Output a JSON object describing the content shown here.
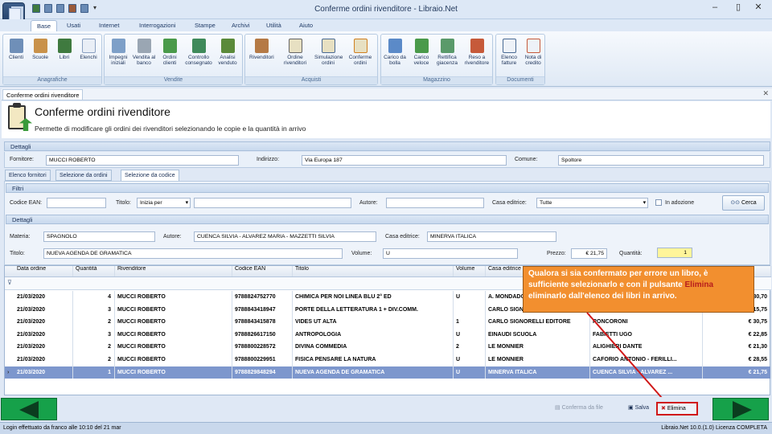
{
  "window": {
    "title": "Conferme ordini rivenditore - Libraio.Net",
    "minimize": "–",
    "maximize": "▯",
    "close": "✕"
  },
  "menu_tabs": [
    "Base",
    "Usati",
    "Internet",
    "Interrogazioni",
    "Stampe",
    "Archivi",
    "Utilità",
    "Aiuto"
  ],
  "ribbon": {
    "anagrafiche": {
      "caption": "Anagrafiche",
      "buttons": [
        "Clienti",
        "Scuole",
        "Libri",
        "Elenchi"
      ]
    },
    "vendite": {
      "caption": "Vendite",
      "buttons": [
        "Impegni iniziali",
        "Vendita al banco",
        "Ordini clienti",
        "Controllo consegnato",
        "Analisi venduto"
      ]
    },
    "acquisti": {
      "caption": "Acquisti",
      "buttons": [
        "Rivenditori",
        "Ordine rivenditori",
        "Simulazione ordini",
        "Conferme ordini"
      ]
    },
    "magazzino": {
      "caption": "Magazzino",
      "buttons": [
        "Carico da bolla",
        "Carico veloce",
        "Rettifica giacenza",
        "Reso a rivenditore"
      ]
    },
    "documenti": {
      "caption": "Documenti",
      "buttons": [
        "Elenco fatture",
        "Nota di credito"
      ]
    }
  },
  "doc_tab": "Conferme ordini rivenditore",
  "header": {
    "title": "Conferme ordini rivenditore",
    "subtitle": "Permette di modificare gli ordini dei rivenditori selezionando le copie e la quantità in arrivo"
  },
  "dettagli": {
    "caption": "Dettagli",
    "fornitore_label": "Fornitore:",
    "fornitore": "MUCCI ROBERTO",
    "indirizzo_label": "Indirizzo:",
    "indirizzo": "Via Europa 187",
    "comune_label": "Comune:",
    "comune": "Spoltore"
  },
  "subtabs": [
    "Elenco fornitori",
    "Selezione da ordini",
    "Selezione da codice"
  ],
  "filtri": {
    "caption": "Filtri",
    "codice_ean_label": "Codice EAN:",
    "titolo_label": "Titolo:",
    "titolo_mode": "Inizia per",
    "autore_label": "Autore:",
    "casa_label": "Casa editrice:",
    "casa_value": "Tutte",
    "in_adozione": "In adozione",
    "cerca": "Cerca"
  },
  "dettagli2": {
    "caption": "Dettagli",
    "materia_label": "Materia:",
    "materia": "SPAGNOLO",
    "autore_label": "Autore:",
    "autore": "CUENCA SILVIA - ALVAREZ MARIA - MAZZETTI SILVIA",
    "casa_label": "Casa editrice:",
    "casa": "MINERVA ITALICA",
    "titolo_label": "Titolo:",
    "titolo": "NUEVA AGENDA DE GRAMATICA",
    "volume_label": "Volume:",
    "volume": "U",
    "prezzo_label": "Prezzo:",
    "prezzo": "€ 21,75",
    "quantita_label": "Quantità:",
    "quantita": "1"
  },
  "grid": {
    "columns": [
      "Data ordine",
      "Quantità",
      "Rivenditore",
      "Codice EAN",
      "Titolo",
      "Volume",
      "Casa editrice",
      "",
      ""
    ],
    "rows": [
      [
        "21/03/2020",
        "4",
        "MUCCI ROBERTO",
        "9788824752770",
        "CHIMICA PER NOI LINEA BLU   2° ED",
        "U",
        "A. MONDADORI SCUOLA",
        "",
        "€ 30,70"
      ],
      [
        "21/03/2020",
        "3",
        "MUCCI ROBERTO",
        "9788843418947",
        "PORTE DELLA LETTERATURA 1 + DIV.COMM.",
        "",
        "CARLO SIGNORELLI EDITORE",
        "",
        "€ 15,75"
      ],
      [
        "21/03/2020",
        "2",
        "MUCCI ROBERTO",
        "9788843415878",
        "VIDES UT ALTA",
        "1",
        "CARLO SIGNORELLI EDITORE",
        "RONCORONI",
        "€ 30,75"
      ],
      [
        "21/03/2020",
        "3",
        "MUCCI ROBERTO",
        "9788826617150",
        "ANTROPOLOGIA",
        "U",
        "EINAUDI SCUOLA",
        "FABIETTI UGO",
        "€ 22,85"
      ],
      [
        "21/03/2020",
        "2",
        "MUCCI ROBERTO",
        "9788800228572",
        "DIVINA COMMEDIA",
        "2",
        "LE MONNIER",
        "ALIGHIERI DANTE",
        "€ 21,30"
      ],
      [
        "21/03/2020",
        "2",
        "MUCCI ROBERTO",
        "9788800229951",
        "FISICA PENSARE LA NATURA",
        "U",
        "LE MONNIER",
        "CAFORIO ANTONIO - FERILLI...",
        "€ 28,55"
      ],
      [
        "21/03/2020",
        "1",
        "MUCCI ROBERTO",
        "9788829848294",
        "NUEVA AGENDA DE GRAMATICA",
        "U",
        "MINERVA ITALICA",
        "CUENCA SILVIA - ALVAREZ ...",
        "€ 21,75"
      ]
    ]
  },
  "callout": {
    "text1": "Qualora si sia confermato per errore un libro, è sufficiente selezionarlo e con il pulsante ",
    "highlight": "Elimina",
    "text2": " eliminarlo dall'elenco dei libri in arrivo."
  },
  "actions": {
    "conferma": "Conferma da file",
    "salva": "Salva",
    "elimina": "Elimina"
  },
  "status": {
    "left": "Login effettuato da franco alle 10:10 del 21 mar",
    "right": "Libraio.Net 10.0.(1.0) Licenza COMPLETA"
  },
  "colors": {
    "accent": "#f28f2f",
    "selected_row": "#7d97cd",
    "nav_green": "#16a14a",
    "elimina_border": "#d01818"
  }
}
